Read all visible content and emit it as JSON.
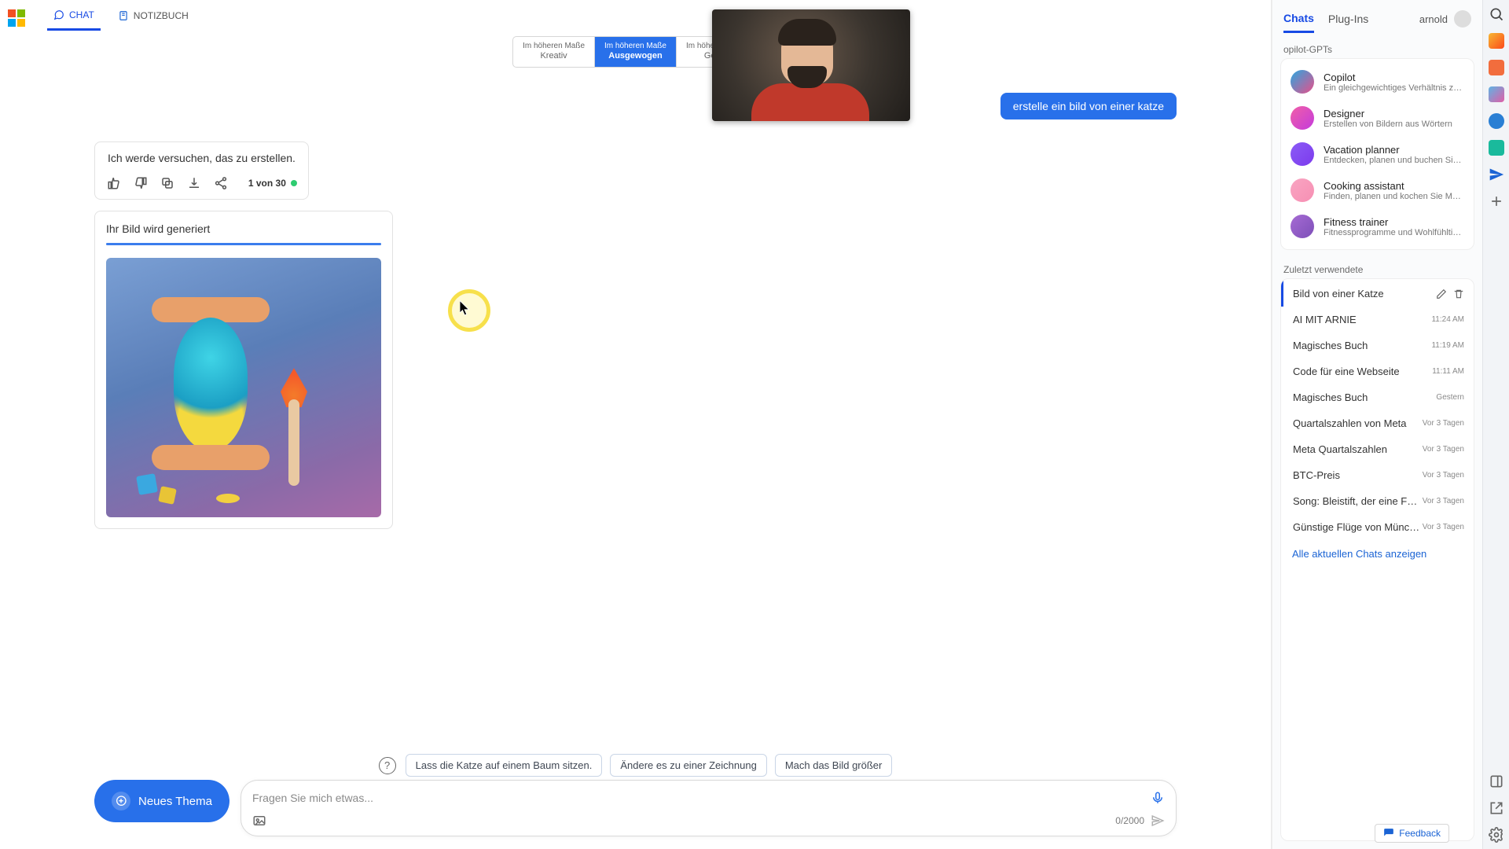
{
  "tabs": {
    "chat": "CHAT",
    "notebook": "NOTIZBUCH"
  },
  "tone": {
    "prefix": "Im höheren Maße",
    "creative": "Kreativ",
    "balanced": "Ausgewogen",
    "precise": "Genau"
  },
  "user_prompt": "erstelle ein bild von einer katze",
  "ai_reply": "Ich werde versuchen, das zu erstellen.",
  "counter": "1 von 30",
  "generating_title": "Ihr Bild wird generiert",
  "suggestions": [
    "Lass die Katze auf einem Baum sitzen.",
    "Ändere es zu einer Zeichnung",
    "Mach das Bild größer"
  ],
  "new_topic": "Neues Thema",
  "placeholder": "Fragen Sie mich etwas...",
  "char_count": "0/2000",
  "side": {
    "tab_chats": "Chats",
    "tab_plugins": "Plug-Ins",
    "user": "arnold",
    "gpt_header": "opilot-GPTs",
    "gpts": [
      {
        "title": "Copilot",
        "desc": "Ein gleichgewichtiges Verhältnis zwischen KI u",
        "color1": "#2aa7e0",
        "color2": "#e84f8a"
      },
      {
        "title": "Designer",
        "desc": "Erstellen von Bildern aus Wörtern",
        "color1": "#f15fa7",
        "color2": "#c43bdc"
      },
      {
        "title": "Vacation planner",
        "desc": "Entdecken, planen und buchen Sie Reisen",
        "color1": "#8b5cf6",
        "color2": "#7c3aed"
      },
      {
        "title": "Cooking assistant",
        "desc": "Finden, planen und kochen Sie Mahlzeiten",
        "color1": "#f8a5c2",
        "color2": "#f78fb3"
      },
      {
        "title": "Fitness trainer",
        "desc": "Fitnessprogramme und Wohlfühltipps",
        "color1": "#a66bd4",
        "color2": "#7d4fb8"
      }
    ],
    "recent_header": "Zuletzt verwendete",
    "recent": [
      {
        "title": "Bild von einer Katze",
        "time": "",
        "active": true
      },
      {
        "title": "AI MIT ARNIE",
        "time": "11:24 AM"
      },
      {
        "title": "Magisches Buch",
        "time": "11:19 AM"
      },
      {
        "title": "Code für eine Webseite",
        "time": "11:11 AM"
      },
      {
        "title": "Magisches Buch",
        "time": "Gestern"
      },
      {
        "title": "Quartalszahlen von Meta",
        "time": "Vor 3 Tagen"
      },
      {
        "title": "Meta Quartalszahlen",
        "time": "Vor 3 Tagen"
      },
      {
        "title": "BTC-Preis",
        "time": "Vor 3 Tagen"
      },
      {
        "title": "Song: Bleistift, der eine Füllfeder sein m",
        "time": "Vor 3 Tagen"
      },
      {
        "title": "Günstige Flüge von München nach Fra",
        "time": "Vor 3 Tagen"
      }
    ],
    "show_all": "Alle aktuellen Chats anzeigen"
  },
  "feedback": "Feedback"
}
